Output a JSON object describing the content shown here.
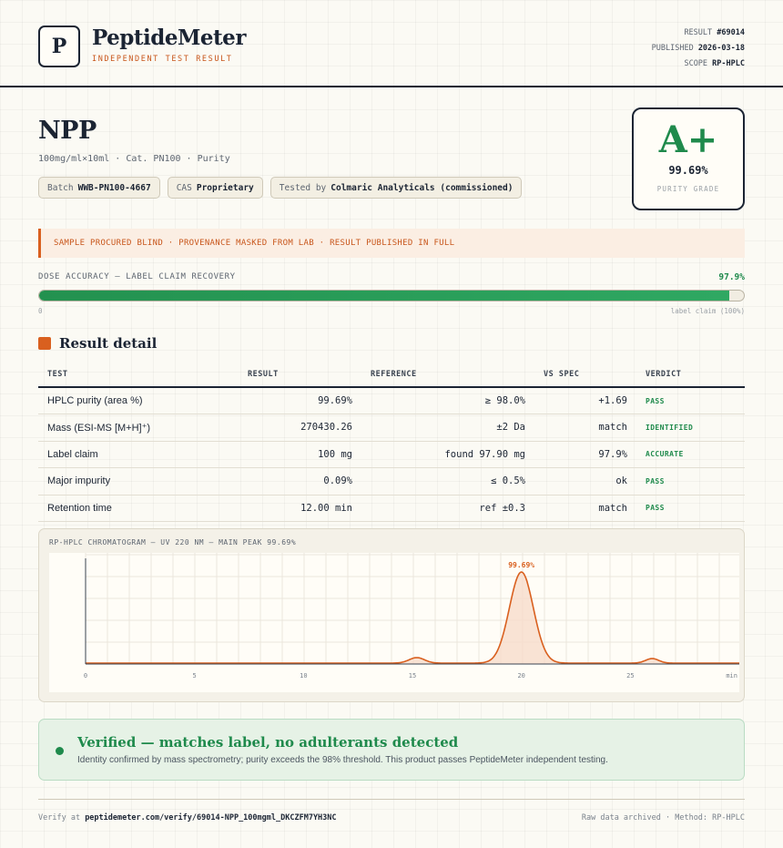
{
  "brand": {
    "logo_letter": "P",
    "name": "PeptideMeter",
    "subtitle": "INDEPENDENT TEST RESULT"
  },
  "meta": {
    "result_label": "RESULT",
    "result_value": "#69014",
    "published_label": "PUBLISHED",
    "published_value": "2026-03-18",
    "scope_label": "SCOPE",
    "scope_value": "RP-HPLC"
  },
  "product": {
    "title": "NPP",
    "subtitle": "100mg/ml×10ml · Cat. PN100 · Purity",
    "chips": [
      {
        "label": "Batch",
        "value": "WWB-PN100-4667"
      },
      {
        "label": "CAS",
        "value": "Proprietary"
      },
      {
        "label": "Tested by",
        "value": "Colmaric Analyticals (commissioned)"
      }
    ]
  },
  "grade": {
    "letter": "A+",
    "value": "99.69%",
    "label": "PURITY GRADE"
  },
  "notice": "SAMPLE PROCURED BLIND · PROVENANCE MASKED FROM LAB · RESULT PUBLISHED IN FULL",
  "dose": {
    "label": "DOSE ACCURACY — LABEL CLAIM RECOVERY",
    "value_text": "97.9%",
    "percent": 97.9,
    "min_label": "0",
    "max_label": "label claim (100%)"
  },
  "section_title": "Result detail",
  "table": {
    "headers": [
      "TEST",
      "RESULT",
      "REFERENCE",
      "VS SPEC",
      "VERDICT"
    ],
    "rows": [
      {
        "test": "HPLC purity (area %)",
        "result": "99.69%",
        "reference": "≥ 98.0%",
        "vs_spec": "+1.69",
        "verdict": "PASS"
      },
      {
        "test": "Mass (ESI-MS [M+H]⁺)",
        "result": "270430.26",
        "reference": "±2 Da",
        "vs_spec": "match",
        "verdict": "IDENTIFIED"
      },
      {
        "test": "Label claim",
        "result": "100 mg",
        "reference": "found 97.90 mg",
        "vs_spec": "97.9%",
        "verdict": "ACCURATE"
      },
      {
        "test": "Major impurity",
        "result": "0.09%",
        "reference": "≤ 0.5%",
        "vs_spec": "ok",
        "verdict": "PASS"
      },
      {
        "test": "Retention time",
        "result": "12.00 min",
        "reference": "ref ±0.3",
        "vs_spec": "match",
        "verdict": "PASS"
      }
    ]
  },
  "chart_data": {
    "type": "line",
    "title": "RP-HPLC CHROMATOGRAM — UV 220 NM — MAIN PEAK 99.69%",
    "xlabel": "min",
    "ylabel": "",
    "xlim": [
      0,
      30
    ],
    "xticks": [
      0,
      5,
      10,
      15,
      20,
      25
    ],
    "x_end_label": "min",
    "peaks": [
      {
        "rt": 15.2,
        "height": 0.06,
        "width": 0.35
      },
      {
        "rt": 20.0,
        "height": 1.0,
        "width": 0.55,
        "label": "99.69%"
      },
      {
        "rt": 26.0,
        "height": 0.05,
        "width": 0.3
      }
    ],
    "baseline": 0.01,
    "grid": true,
    "line_color": "#d9601f",
    "fill_color": "#f7dccb"
  },
  "verified": {
    "title": "Verified — matches label, no adulterants detected",
    "text": "Identity confirmed by mass spectrometry; purity exceeds the 98% threshold. This product passes PeptideMeter independent testing."
  },
  "footer": {
    "verify_prefix": "Verify at",
    "verify_url": "peptidemeter.com/verify/69014-NPP_100mgml_DKCZFM7YH3NC",
    "right": "Raw data archived · Method: RP-HPLC"
  },
  "colors": {
    "accent": "#d9601f",
    "pass": "#1f8a4c",
    "ink": "#1b2433"
  }
}
